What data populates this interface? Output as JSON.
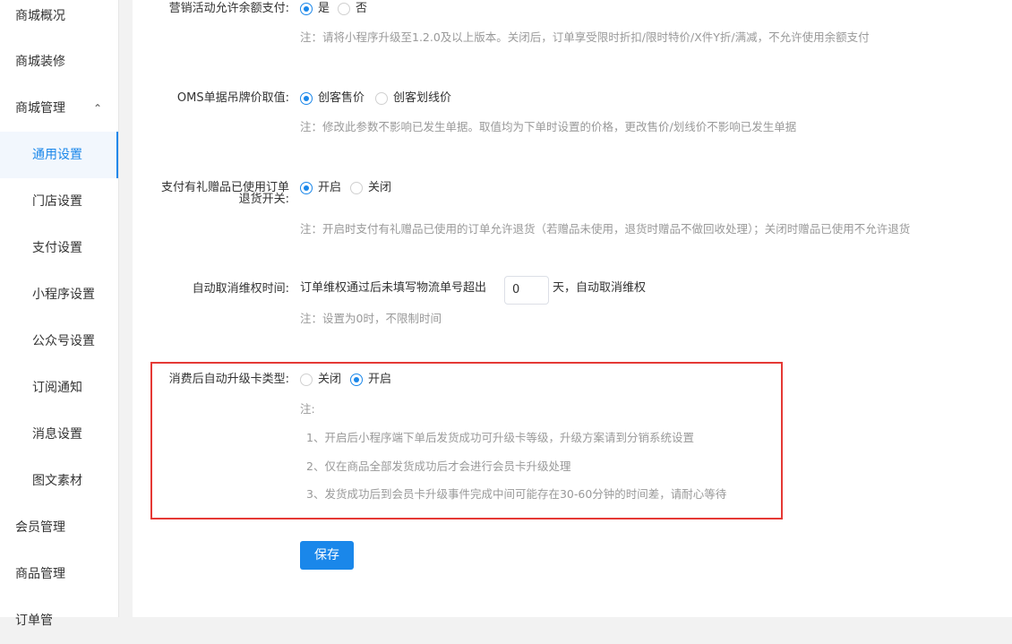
{
  "sidebar": {
    "items": [
      {
        "label": "商城概况"
      },
      {
        "label": "商城装修"
      },
      {
        "label": "商城管理"
      },
      {
        "label": "通用设置"
      },
      {
        "label": "门店设置"
      },
      {
        "label": "支付设置"
      },
      {
        "label": "小程序设置"
      },
      {
        "label": "公众号设置"
      },
      {
        "label": "订阅通知"
      },
      {
        "label": "消息设置"
      },
      {
        "label": "图文素材"
      },
      {
        "label": "会员管理"
      },
      {
        "label": "商品管理"
      },
      {
        "label": "订单管"
      }
    ],
    "expand_icon": "chevron-up-icon",
    "active_color": "#1a87ea"
  },
  "settings": {
    "balance_pay": {
      "label": "营销活动允许余额支付:",
      "options": [
        "是",
        "否"
      ],
      "selected": "是",
      "note": "注：请将小程序升级至1.2.0及以上版本。关闭后，订单享受限时折扣/限时特价/X件Y折/满减，不允许使用余额支付"
    },
    "oms_price": {
      "label": "OMS单据吊牌价取值:",
      "options": [
        "创客售价",
        "创客划线价"
      ],
      "selected": "创客售价",
      "note": "注：修改此参数不影响已发生单据。取值均为下单时设置的价格，更改售价/划线价不影响已发生单据"
    },
    "gift_refund": {
      "label_line1": "支付有礼赠品已使用订单",
      "label_line2": "退货开关:",
      "options": [
        "开启",
        "关闭"
      ],
      "selected": "开启",
      "note": "注：开启时支付有礼赠品已使用的订单允许退货（若赠品未使用，退货时赠品不做回收处理）；关闭时赠品已使用不允许退货"
    },
    "auto_cancel": {
      "label": "自动取消维权时间:",
      "prefix": "订单维权通过后未填写物流单号超出",
      "value": "0",
      "suffix": "天，自动取消维权",
      "note": "注：设置为0时，不限制时间"
    },
    "auto_upgrade": {
      "label": "消费后自动升级卡类型:",
      "options": [
        "关闭",
        "开启"
      ],
      "selected": "开启",
      "note_title": "注:",
      "notes": [
        "1、开启后小程序端下单后发货成功可升级卡等级，升级方案请到分销系统设置",
        "2、仅在商品全部发货成功后才会进行会员卡升级处理",
        "3、发货成功后到会员卡升级事件完成中间可能存在30-60分钟的时间差，请耐心等待"
      ]
    }
  },
  "actions": {
    "save_label": "保存"
  },
  "colors": {
    "primary": "#1a87ea",
    "highlight_border": "#e53935",
    "note_text": "#999999"
  }
}
